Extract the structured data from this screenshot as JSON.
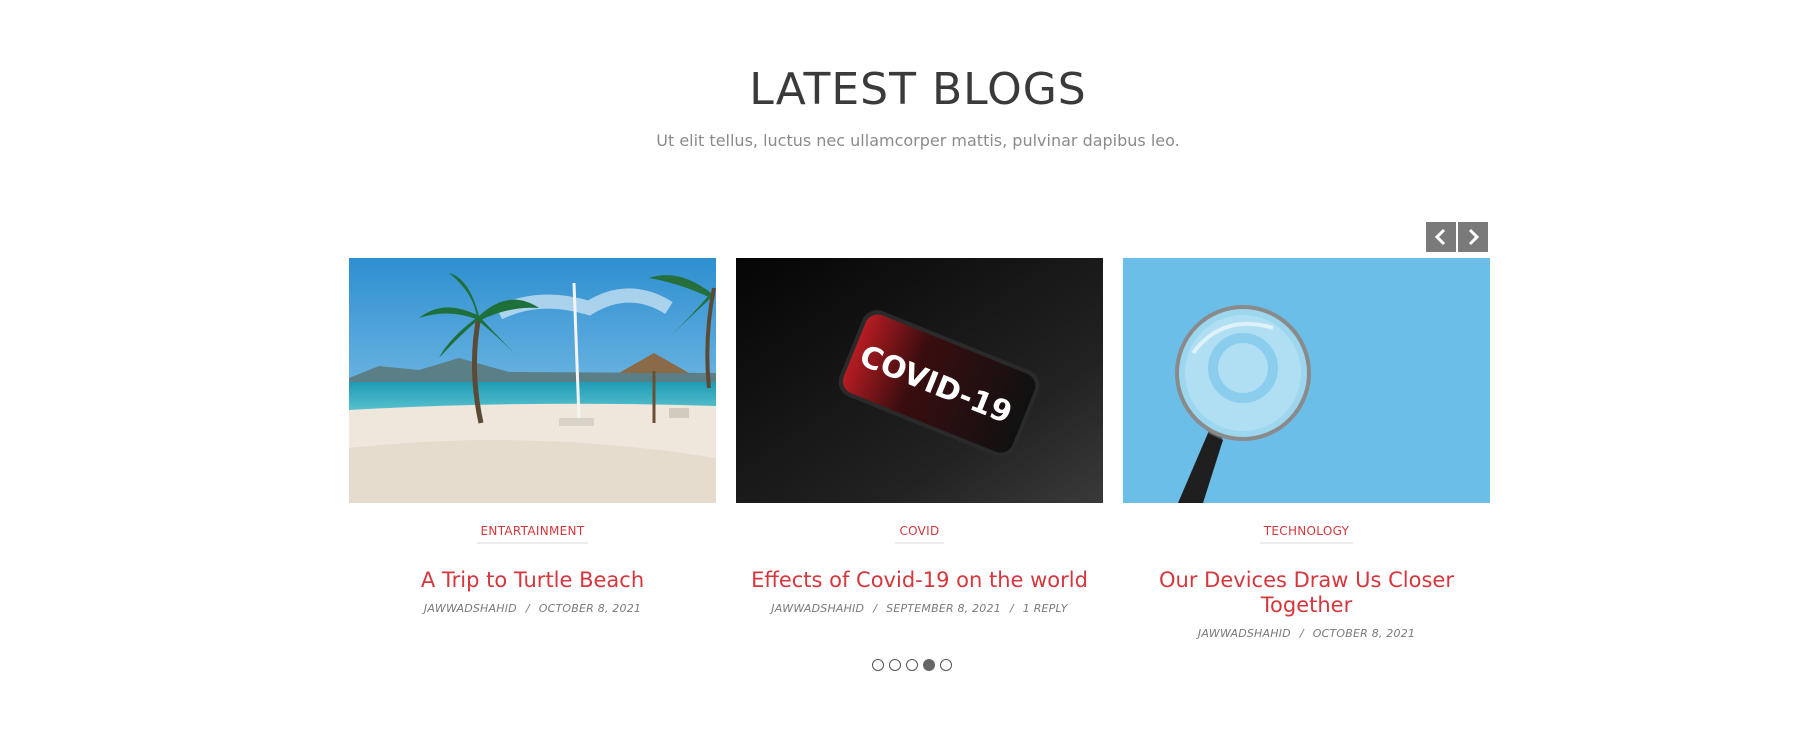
{
  "section": {
    "title": "LATEST BLOGS",
    "subtitle": "Ut elit tellus, luctus nec ullamcorper mattis, pulvinar dapibus leo."
  },
  "carousel": {
    "prev_icon": "chevron-left-icon",
    "next_icon": "chevron-right-icon",
    "active_dot_index": 3,
    "dot_count": 5
  },
  "posts": [
    {
      "image": "beach-palm-trees-image",
      "category": "ENTARTAINMENT",
      "title": "A Trip to Turtle Beach",
      "author": "JAWWADSHAHID",
      "separator": "/",
      "date": "OCTOBER 8, 2021",
      "replies": ""
    },
    {
      "image": "covid-phone-image",
      "category": "COVID",
      "title": "Effects of Covid-19 on the world",
      "author": "JAWWADSHAHID",
      "separator": "/",
      "date": "SEPTEMBER 8, 2021",
      "replies": "1 REPLY",
      "image_text": "COVID-19"
    },
    {
      "image": "magnifying-glass-image",
      "category": "TECHNOLOGY",
      "title": "Our Devices Draw Us Closer Together",
      "author": "JAWWADSHAHID",
      "separator": "/",
      "date": "OCTOBER 8, 2021",
      "replies": ""
    }
  ],
  "colors": {
    "accent": "#d5373d",
    "title_text": "#3a3a3a",
    "muted_text": "#8b8b8b",
    "nav_button_bg": "#7a7a7a",
    "magnifier_bg": "#5fb8e6"
  }
}
